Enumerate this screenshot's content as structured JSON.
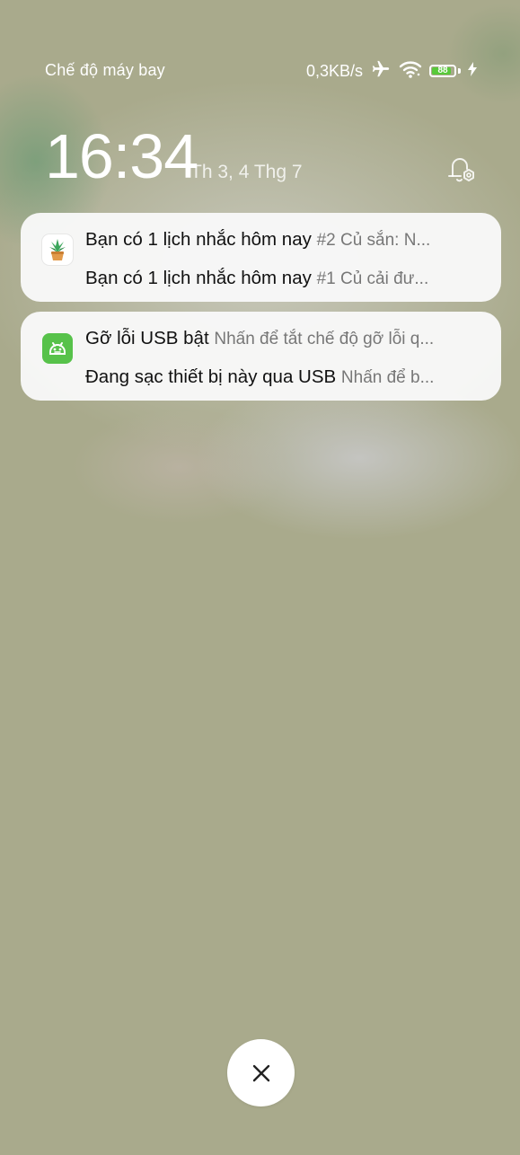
{
  "status_bar": {
    "mode_text": "Chế độ máy bay",
    "net_speed": "0,3KB/s",
    "battery_level": "88",
    "battery_percent": 88,
    "battery_color": "#58c93a",
    "icons": [
      "airplane-icon",
      "wifi-icon",
      "battery-icon",
      "charging-bolt-icon"
    ]
  },
  "lockscreen": {
    "time": "16:34",
    "date": "Th 3, 4 Thg 7"
  },
  "notifications": [
    {
      "app_icon": "plant-icon",
      "items": [
        {
          "title": "Bạn có 1 lịch nhắc hôm nay",
          "message": "#2 Củ sắn: N..."
        },
        {
          "title": "Bạn có 1 lịch nhắc hôm nay",
          "message": "#1 Củ cải đư..."
        }
      ]
    },
    {
      "app_icon": "android-icon",
      "app_icon_color": "#57c24a",
      "items": [
        {
          "title": "Gỡ lỗi USB bật",
          "message": "Nhấn để tắt chế độ gỡ lỗi q..."
        },
        {
          "title": "Đang sạc thiết bị này qua USB",
          "message": "Nhấn để b..."
        }
      ]
    }
  ],
  "clear_button": {
    "icon": "close-icon"
  }
}
